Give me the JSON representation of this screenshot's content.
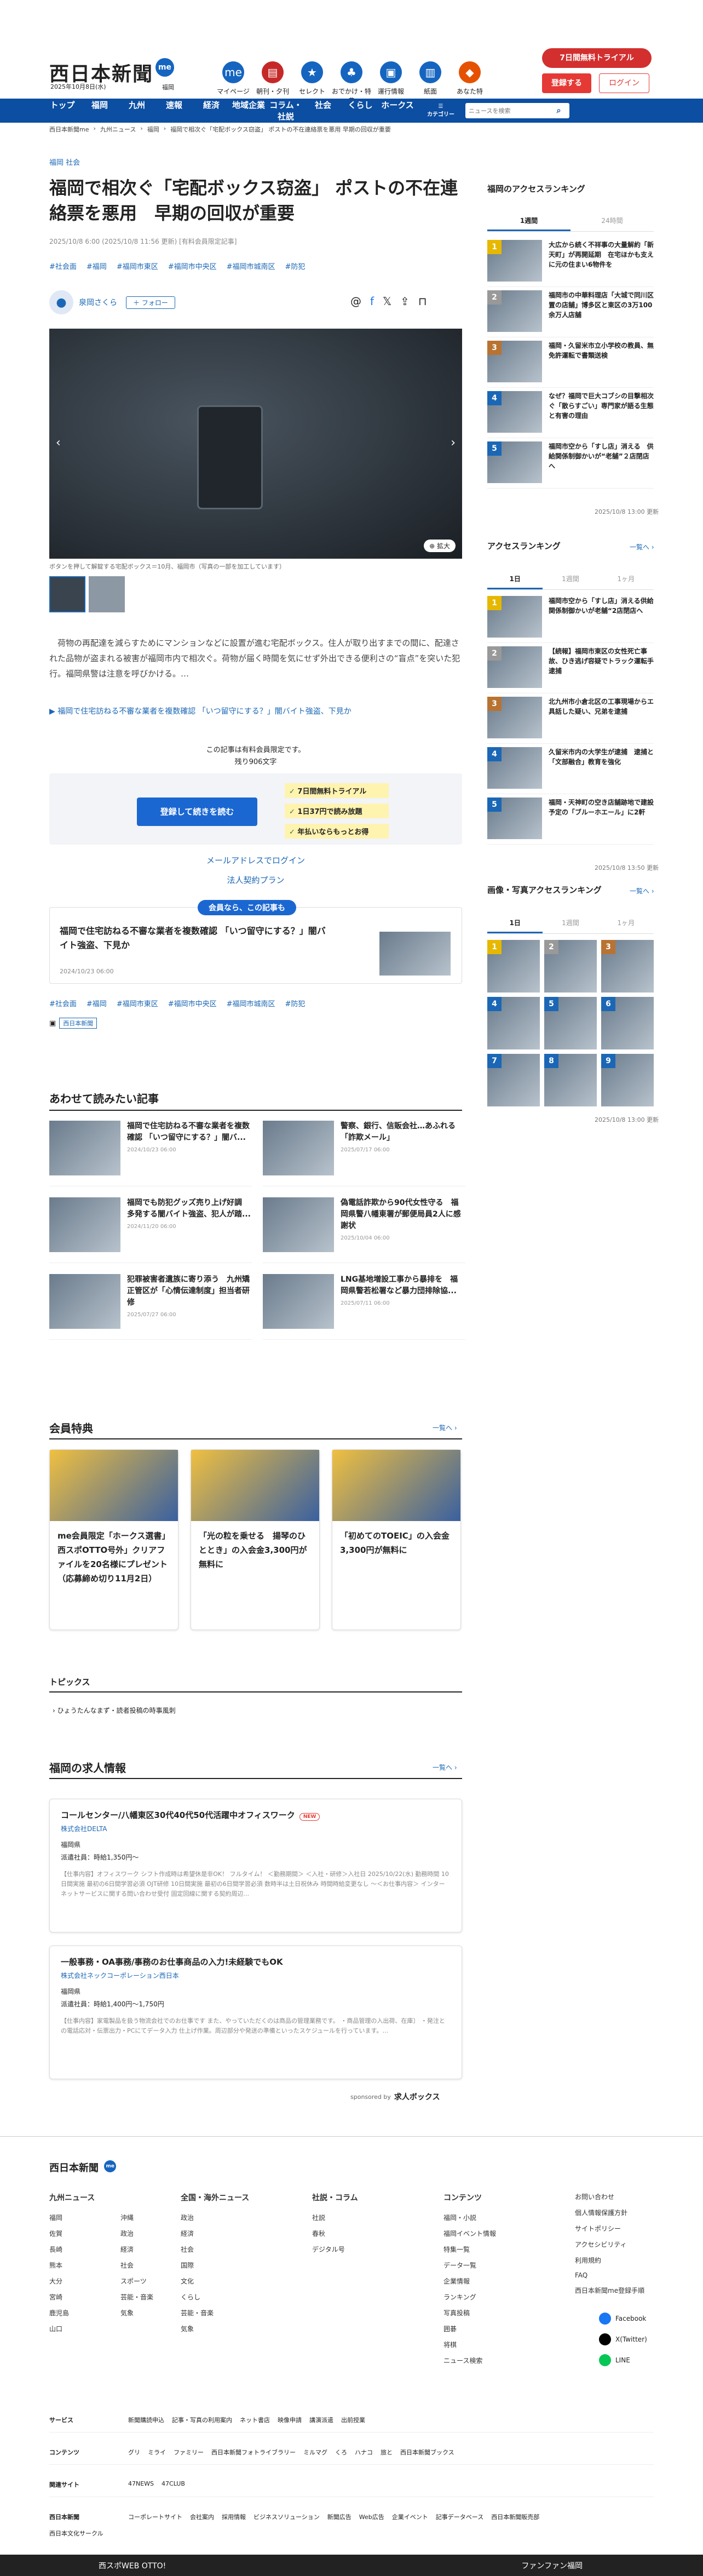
{
  "header": {
    "logo": "西日本新聞",
    "logo_badge": "me",
    "date": "2025年10月8日(水)",
    "region": "福岡",
    "icons": [
      {
        "label": "マイページ",
        "color": "#1565c0",
        "glyph": "me"
      },
      {
        "label": "朝刊・夕刊",
        "color": "#c62828",
        "glyph": "▤"
      },
      {
        "label": "セレクト",
        "color": "#1565c0",
        "glyph": "★"
      },
      {
        "label": "おでかけ・特典",
        "color": "#1565c0",
        "glyph": "♣"
      },
      {
        "label": "運行情報",
        "color": "#1565c0",
        "glyph": "▣"
      },
      {
        "label": "紙面",
        "color": "#1565c0",
        "glyph": "▥"
      },
      {
        "label": "あなた特",
        "color": "#e65100",
        "glyph": "◆"
      }
    ],
    "trial": "7日間無料トライアル",
    "register": "登録する",
    "login": "ログイン"
  },
  "nav": {
    "items": [
      "トップ",
      "福岡",
      "九州",
      "速報",
      "経済",
      "地域企業",
      "コラム・社説",
      "社会",
      "くらし",
      "ホークス"
    ],
    "category_label": "カテゴリー",
    "search_placeholder": "ニュースを検索"
  },
  "breadcrumb": [
    "西日本新聞me",
    "九州ニュース",
    "福岡",
    "福岡で相次ぐ「宅配ボックス窃盗」 ポストの不在連絡票を悪用 早期の回収が重要"
  ],
  "article": {
    "category": "福岡 社会",
    "title": "福岡で相次ぐ「宅配ボックス窃盗」 ポストの不在連絡票を悪用　早期の回収が重要",
    "date": "2025/10/8 6:00 (2025/10/8 11:56 更新) [有料会員限定記事]",
    "tags": [
      "#社会面",
      "#福岡",
      "#福岡市東区",
      "#福岡市中央区",
      "#福岡市城南区",
      "#防犯"
    ],
    "author": "泉岡さくら",
    "follow": "＋ フォロー",
    "zoom": "拡大",
    "caption": "ボタンを押して解錠する宅配ボックス＝10月、福岡市（写真の一部を加工しています）",
    "body": "　荷物の再配達を減らすためにマンションなどに設置が進む宅配ボックス。住人が取り出すまでの間に、配達された品物が盗まれる被害が福岡市内で相次ぐ。荷物が届く時間を気にせず外出できる便利さの“盲点”を突いた犯行。福岡県警は注意を呼びかける。…",
    "related_link": "▶ 福岡で住宅訪ねる不審な業者を複数確認 「いつ留守にする？」闇バイト強盗、下見か",
    "paywall": {
      "line1": "この記事は有料会員限定です。",
      "line2": "残り906文字",
      "cta": "登録して続きを読む",
      "benefits": [
        "7日間無料トライアル",
        "1日37円で読み放題",
        "年払いならもっとお得"
      ],
      "email_login": "メールアドレスでログイン",
      "corporate": "法人契約プラン"
    },
    "member_box": {
      "label": "会員なら、この記事も",
      "title": "福岡で住宅訪ねる不審な業者を複数確認 「いつ留守にする？」闇バイト強盗、下見か",
      "date": "2024/10/23 06:00"
    },
    "source_badge": "西日本新聞"
  },
  "also_read": {
    "title": "あわせて読みたい記事",
    "items": [
      {
        "title": "福岡で住宅訪ねる不審な業者を複数確認 「いつ留守にする？」闇バ...",
        "date": "2024/10/23 06:00"
      },
      {
        "title": "警察、銀行、信販会社…あふれる「詐欺メール」",
        "date": "2025/07/17 06:00"
      },
      {
        "title": "福岡でも防犯グッズ売り上げ好調　多発する闇バイト強盗、犯人が踏...",
        "date": "2024/11/20 06:00"
      },
      {
        "title": "偽電話詐欺から90代女性守る　福岡県警八幡東署が郵便局員2人に感謝状",
        "date": "2025/10/04 06:00"
      },
      {
        "title": "犯罪被害者遺族に寄り添う　九州矯正管区が「心情伝達制度」担当者研修",
        "date": "2025/07/27 06:00"
      },
      {
        "title": "LNG基地増設工事から暴排を　福岡県警若松署など暴力団排除協...",
        "date": "2025/07/11 06:00"
      }
    ]
  },
  "benefits": {
    "title": "会員特典",
    "more": "一覧へ",
    "items": [
      {
        "title": "me会員限定「ホークス選書」西スポOTTO号外」クリアファイルを20名様にプレゼント（応募締め切り11月2日）"
      },
      {
        "title": "「光の粒を乗せる　揚琴のひととき」の入会金3,300円が無料に"
      },
      {
        "title": "「初めてのTOEIC」の入会金3,300円が無料に"
      }
    ]
  },
  "topics": {
    "title": "トピックス",
    "item": "ひょうたんなまず・読者投稿の時事風刺"
  },
  "jobs": {
    "title": "福岡の求人情報",
    "more": "一覧へ",
    "items": [
      {
        "title": "コールセンター/八幡東区30代40代50代活躍中オフィスワーク",
        "badge": "NEW",
        "company": "株式会社DELTA",
        "location": "福岡県",
        "wage": "派遣社員：時給1,350円～",
        "desc": "【仕事内容】オフィスワーク シフト作成時は希望休是非OK！ フルタイム！ ＜勤務期間＞ ＜入社・研修＞入社日 2025/10/22(水) 勤務時間 10日間実施 最初の6日間学習必須 OJT研修 10日間実施 最初の6日間学習必須 数時半は土日祝休み 時間時給変更なし 〜＜お仕事内容＞ インターネットサービスに関する問い合わせ受付 固定回線に関する契約周辺..."
      },
      {
        "title": "一般事務・OA事務/事務のお仕事商品の入力!未経験でもOK",
        "badge": "",
        "company": "株式会社ネックコーポレーション西日本",
        "location": "福岡県",
        "wage": "派遣社員：時給1,400円～1,750円",
        "desc": "【仕事内容】家電製品を扱う物流会社でのお仕事です また、やっていただくのは商品の管理業務です。 ・商品管理の入出荷、在庫〕 ・発注との電話応対・伝票出力・PCにてデータ入力 仕上げ作業。周辺部分や発送の準備といったスケジュールを行っています。…"
      }
    ],
    "sponsor": "sponsored by",
    "sponsor_name": "求人ボックス"
  },
  "sidebar": {
    "access_title": "福岡のアクセスランキング",
    "tabs1": [
      "1週間",
      "24時間"
    ],
    "week": [
      {
        "t": "大広から続く不祥事の大量解約「新天町」が再開延期　在宅ほかも支えに元の住まい6物件を"
      },
      {
        "t": "福岡市の中華料理店「大城で同川区置の店舗」博多区と東区の3万100余万人店舗"
      },
      {
        "t": "福岡・久留米市立小学校の教員、無免許運転で書類送検"
      },
      {
        "t": "なぜ？福岡で巨大コブシの目撃相次ぐ「散らすごい」専門家が語る生態と有害の理由"
      },
      {
        "t": "福岡市空から「すし店」消える　供給関係制御かいが“老舗”２店閉店へ"
      }
    ],
    "week_update": "2025/10/8 13:00 更新",
    "access2_title": "アクセスランキング",
    "access2_more": "一覧へ",
    "tabs2": [
      "1日",
      "1週間",
      "1ヶ月"
    ],
    "day": [
      {
        "t": "福岡市空から「すし店」消える供給関係制御かいが老舗“2店閉店へ"
      },
      {
        "t": "【続報】福岡市東区の女性死亡事故、ひき逃げ容疑でトラック運転手逮捕"
      },
      {
        "t": "北九州市小倉北区の工事現場からエ具話した疑い、兄弟を逮捕"
      },
      {
        "t": "久留米市内の大学生が逮捕　逮捕と「文部融合」教育を強化"
      },
      {
        "t": "福岡・天神町の空き店舗跡地で建設予定の「ブルーホエール」に2軒"
      }
    ],
    "day_update": "2025/10/8 13:50 更新",
    "photo_title": "画像・写真アクセスランキング",
    "photo_more": "一覧へ",
    "tabs3": [
      "1日",
      "1週間",
      "1ヶ月"
    ],
    "photo_update": "2025/10/8 13:00 更新"
  },
  "footer": {
    "logo": "西日本新聞",
    "cols": [
      {
        "title": "九州ニュース",
        "items": [
          "福岡",
          "佐賀",
          "長崎",
          "熊本",
          "大分",
          "宮崎",
          "鹿児島",
          "山口",
          "沖縄",
          "政治",
          "経済",
          "社会",
          "スポーツ",
          "芸能・音楽",
          "気象"
        ]
      },
      {
        "title": "全国・海外ニュース",
        "items": [
          "政治",
          "経済",
          "社会",
          "国際",
          "文化",
          "くらし",
          "芸能・音楽",
          "気象"
        ]
      },
      {
        "title": "社説・コラム",
        "items": [
          "社説",
          "春秋",
          "デジタル号"
        ]
      },
      {
        "title": "コンテンツ",
        "items": [
          "福岡・小説",
          "福岡イベント情報",
          "特集一覧",
          "データ一覧",
          "企業情報",
          "ランキング",
          "写真投稿",
          "囲碁",
          "将棋",
          "ニュース検索"
        ]
      },
      {
        "title": "",
        "items": [
          "お問い合わせ",
          "個人情報保護方針",
          "サイトポリシー",
          "アクセシビリティ",
          "利用規約",
          "FAQ",
          "西日本新聞me登録手順"
        ]
      }
    ],
    "social": [
      "Facebook",
      "X(Twitter)",
      "LINE"
    ],
    "services_label": "サービス",
    "services": [
      "新聞購読申込",
      "記事・写真の利用案内",
      "ネット書店",
      "映像申請",
      "講演派遣",
      "出前授業"
    ],
    "contents_label": "コンテンツ",
    "contents": [
      "グリ",
      "ミライ",
      "ファミリー",
      "西日本新聞フォトライブラリー",
      "ミルマグ",
      "くろ",
      "ハナコ",
      "旅と",
      "西日本新聞ブックス"
    ],
    "related_label": "関連サイト",
    "related": [
      "47NEWS",
      "47CLUB"
    ],
    "corp_links": [
      "コーポレートサイト",
      "会社案内",
      "採用情報",
      "ビジネスソリューション",
      "新聞広告",
      "Web広告",
      "企業イベント",
      "記事データベース",
      "西日本新聞販売部",
      "西日本文化サークル"
    ]
  },
  "bottom_banner": {
    "left": "西スポWEB OTTO!",
    "right": "ファンファン福岡"
  }
}
